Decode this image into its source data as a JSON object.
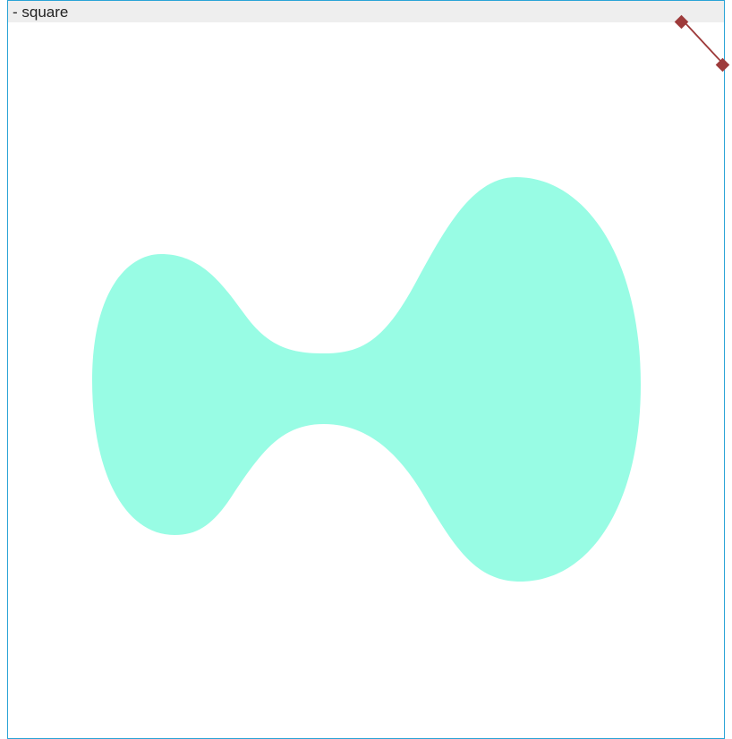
{
  "artboard": {
    "title": "- square"
  },
  "colors": {
    "artboard_border": "#29a3d6",
    "title_bar_bg": "#eeeeee",
    "shape_fill": "#98fce4",
    "handle_color": "#9e3b3b"
  },
  "shape": {
    "name": "blob-shape"
  },
  "handle": {
    "name": "resize-handle"
  }
}
